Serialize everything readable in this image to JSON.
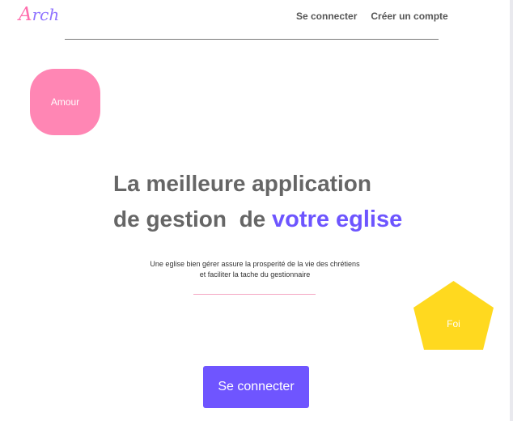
{
  "logo": {
    "initial": "A",
    "rest": "rch"
  },
  "nav": {
    "items": [
      {
        "label": "Se connecter"
      },
      {
        "label": "Créer un compte"
      }
    ]
  },
  "badges": {
    "amour": "Amour",
    "foi": "Foi"
  },
  "hero": {
    "line1": "La meilleure application",
    "line2_prefix": "de gestion  de ",
    "line2_accent": "votre eglise",
    "sub_line1": "Une eglise bien gérer assure la prosperité de la vie des chrétiens",
    "sub_line2": "et faciliter la tache du gestionnaire"
  },
  "cta": {
    "label": "Se connecter"
  },
  "colors": {
    "accent": "#6f55ff",
    "pink": "#ff86b4",
    "yellow": "#ffd91f",
    "text": "#666666"
  }
}
